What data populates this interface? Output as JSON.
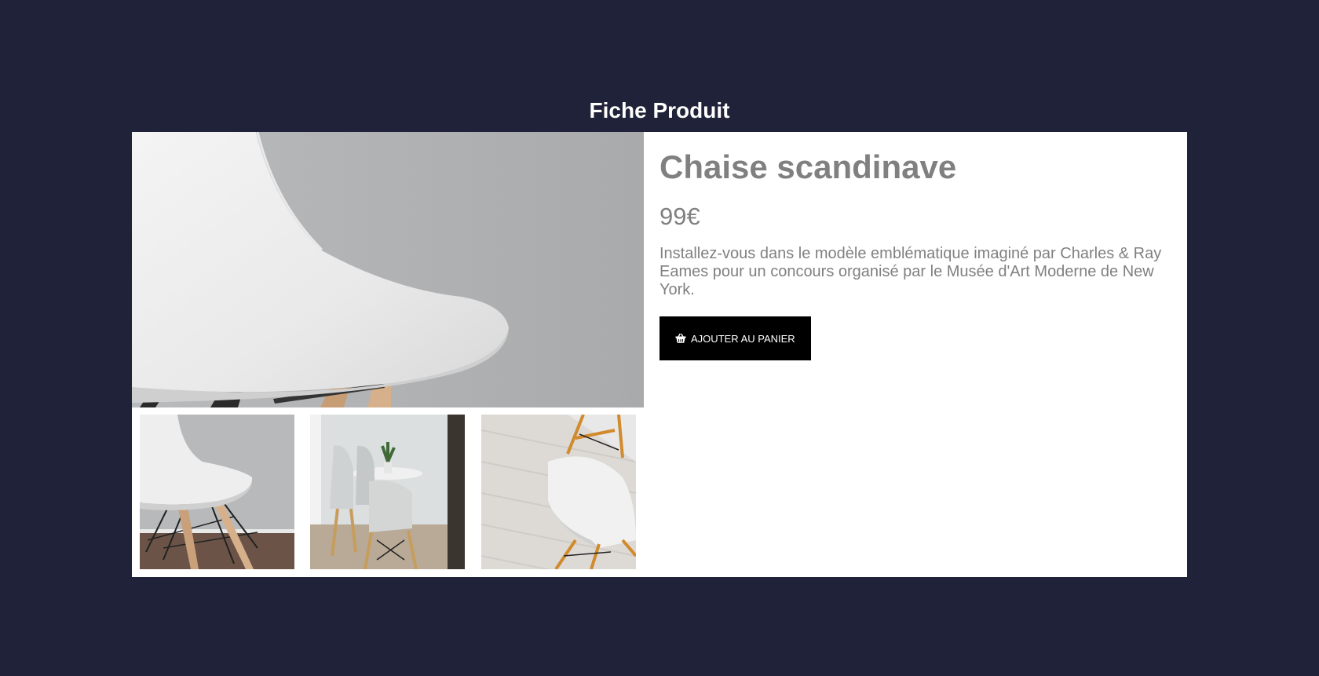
{
  "header": {
    "title": "Fiche Produit"
  },
  "product": {
    "name": "Chaise scandinave",
    "price": "99€",
    "description": "Installez-vous dans le modèle emblématique imaginé par Charles & Ray Eames pour un concours organisé par le Musée d'Art Moderne de New York.",
    "add_to_cart_label": "AJOUTER AU PANIER",
    "add_to_cart_icon": "basket-icon"
  },
  "gallery": {
    "main_image": "chair-closeup-photo",
    "thumbnails": [
      "chair-side-photo",
      "chairs-table-photo",
      "chair-floor-photo"
    ]
  },
  "colors": {
    "background": "#1f2238",
    "card": "#ffffff",
    "text_muted": "#808080",
    "button": "#000000"
  }
}
